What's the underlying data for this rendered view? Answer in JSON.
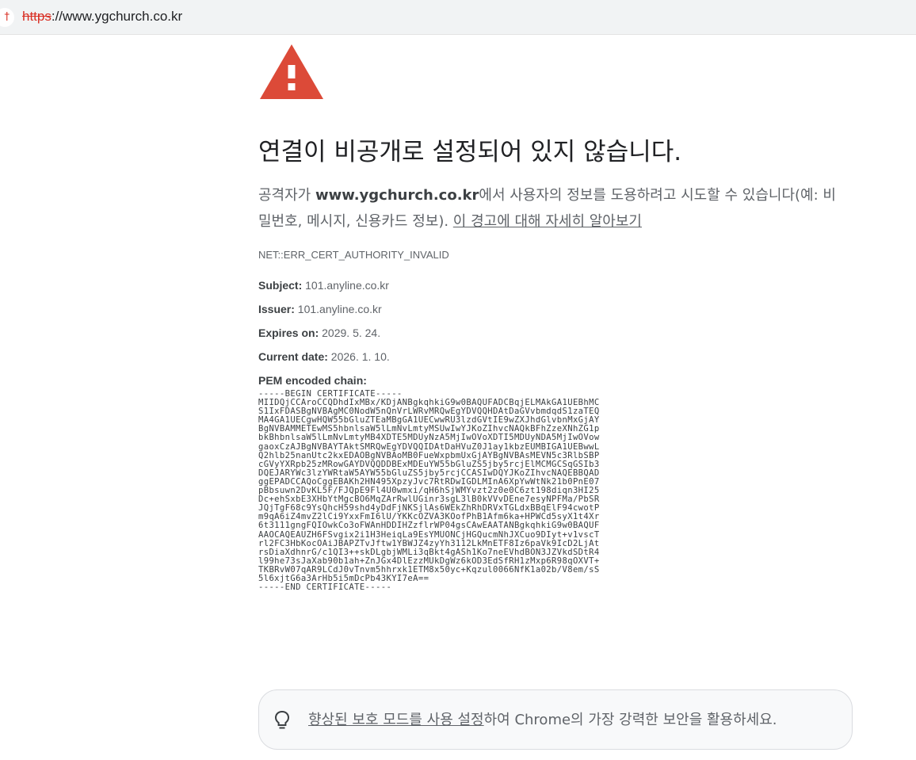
{
  "address_bar": {
    "left_icon_glyph": "†",
    "url_scheme": "https",
    "url_rest": "://www.ygchurch.co.kr"
  },
  "icons": {
    "warning": "warning-triangle-icon",
    "bulb": "lightbulb-icon",
    "warning_color": "#dc4a38"
  },
  "interstitial": {
    "heading": "연결이 비공개로 설정되어 있지 않습니다.",
    "explain_prefix": "공격자가 ",
    "explain_host": "www.ygchurch.co.kr",
    "explain_suffix": "에서 사용자의 정보를 도용하려고 시도할 수 있습니다(예: 비밀번호, 메시지, 신용카드 정보). ",
    "learn_more_link": "이 경고에 대해 자세히 알아보기",
    "error_code": "NET::ERR_CERT_AUTHORITY_INVALID"
  },
  "certificate": {
    "subject_label": "Subject:",
    "subject_value": " 101.anyline.co.kr",
    "issuer_label": "Issuer:",
    "issuer_value": " 101.anyline.co.kr",
    "expires_label": "Expires on:",
    "expires_value": " 2029. 5. 24.",
    "current_label": "Current date:",
    "current_value": " 2026. 1. 10.",
    "pem_label": "PEM encoded chain:",
    "pem_text": "-----BEGIN CERTIFICATE-----\nMIIDQjCCAroCCQDhdIxMBx/KDjANBgkqhkiG9w0BAQUFADCBqjELMAkGA1UEBhMC\nS1IxFDASBgNVBAgMC0NodW5nQnVrLWRvMRQwEgYDVQQHDAtDaGVvbmdqdS1zaTEQ\nMA4GA1UECgwHQW55bGluZTEaMBgGA1UECwwRU3lzdGVtIE9wZXJhdGlvbnMxGjAY\nBgNVBAMMETEwMS5hbnlsaW5lLmNvLmtyMSUwIwYJKoZIhvcNAQkBFhZzeXNhZG1p\nbkBhbnlsaW5lLmNvLmtyMB4XDTE5MDUyNzA5MjIwOVoXDTI5MDUyNDA5MjIwOVow\ngaoxCzAJBgNVBAYTAktSMRQwEgYDVQQIDAtDaHVuZ0J1ay1kbzEUMBIGA1UEBwwL\nQ2hlb25nanUtc2kxEDAOBgNVBAoMB0FueWxpbmUxGjAYBgNVBAsMEVN5c3RlbSBP\ncGVyYXRpb25zMRowGAYDVQQDDBExMDEuYW55bGluZS5jby5rcjElMCMGCSqGSIb3\nDQEJARYWc3lzYWRtaW5AYW55bGluZS5jby5rcjCCASIwDQYJKoZIhvcNAQEBBQAD\nggEPADCCAQoCggEBAKh2HN495XpzyJvc7RtRDwIGDLMInA6XpYwWtNk21b0PnE07\npBbsuwn2DvKL5F/FJQpE9Fl4U0wmxi/qH6hSjWMYvzt2z0e0C6zt198diqn3HI25\nDc+ehSxbE3XHbYtMgcBO6MqZArRwlUGinr3sgL3lB0kVVvDEne7esyNPFMa/PbSR\nJQjTgF68c9YsQhcH59shd4yDdFjNKSjlAs6WEkZhRhDRVxTGLdxBBqElF94cwotP\nm9qA6iZ4mvZ2lCi9YxxFmI6lU/YKKcOZVA3KOofPhB1Afm6ka+HPWCd5syX1t4Xr\n6t3111gngFQIOwkCo3oFWAnHDDIHZzflrWP04gsCAwEAATANBgkqhkiG9w0BAQUF\nAAOCAQEAUZH6FSvgix2i1H3HeiqLa9EsYMUONCjHGQucmNhJXCuo9DIyt+v1vscT\nrl2FC3HbKocOAiJBAPZTvJftw1YBWJZ4zyYh3112LkMnETF8Iz6paVk9IcD2LjAt\nrsDiaXdhnrG/c1QI3++skDLgbjWMLi3qBkt4gASh1Ko7neEVhdBON3JZVkdSDtR4\nl99he73sJaXab90b1ah+ZnJGx4DlEzzMUkDgWz6kOD3EdSfRH1zMxp6R98qOXVT+\nTKBRvW07qAR9LCdJ0vTnvm5hhrxk1ETM8x50yc+Kqzul0066NfK1a02b/V8em/sS\n5l6xjtG6a3ArHb5i5mDcPb43KYI7eA==\n-----END CERTIFICATE-----"
  },
  "enhanced_protection": {
    "link_text": "향상된 보호 모드를 사용 설정",
    "suffix_text": "하여 Chrome의 가장 강력한 보안을 활용하세요."
  }
}
